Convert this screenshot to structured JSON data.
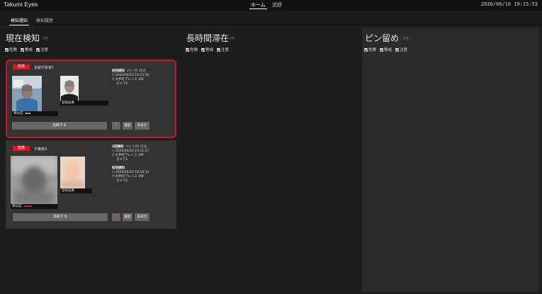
{
  "app": {
    "title": "Takumi Eyes",
    "clock": "2020/06/10 19:15:53"
  },
  "nav": {
    "home": "ホーム",
    "track": "追跡"
  },
  "subtabs": {
    "notifications": "検知通知",
    "history": "検知履歴"
  },
  "columns": [
    {
      "title": "現在検知",
      "count": "2件"
    },
    {
      "title": "長時間滞在",
      "count": "0件"
    },
    {
      "title": "ピン留め",
      "count": "0件"
    }
  ],
  "filters": {
    "danger": "危険",
    "warning": "警戒",
    "caution": "注意"
  },
  "cards": [
    {
      "badge": "危険",
      "name": "追跡対象者C",
      "detected_label": "類似度",
      "registered_label": "登録画像",
      "detections": [
        {
          "title": "初回検知",
          "ago": "2分 3秒 経過",
          "time": "2020/06/10 19:12:50",
          "place": "大手町プレイス 29F",
          "camera": "カメラ1"
        }
      ],
      "track_button": "追跡する",
      "history_button": "履歴",
      "hide_button": "非表示",
      "similarity_dots": [
        "#e5c02a",
        "#e5c02a"
      ]
    },
    {
      "badge": "危険",
      "name": "不審者A",
      "detected_label": "類似度",
      "registered_label": "登録画像",
      "detections": [
        {
          "title": "2回検知",
          "ago": "4分 24秒 経過",
          "time": "2020/06/10 19:11:27",
          "place": "大手町プレイス 29F",
          "camera": "カメラ1"
        },
        {
          "title": "初回検知",
          "ago": "",
          "time": "2020/06/10 19:10:33",
          "place": "大手町プレイス 29F",
          "camera": "カメラ1"
        }
      ],
      "track_button": "追跡する",
      "history_button": "履歴",
      "hide_button": "非表示",
      "similarity_dots": [
        "#e0151d",
        "#e0151d",
        "#e0151d"
      ]
    }
  ],
  "colors": {
    "danger": "#e0151d",
    "highlight_border": "#d0161d",
    "similarity_mid": "#e5c02a"
  }
}
